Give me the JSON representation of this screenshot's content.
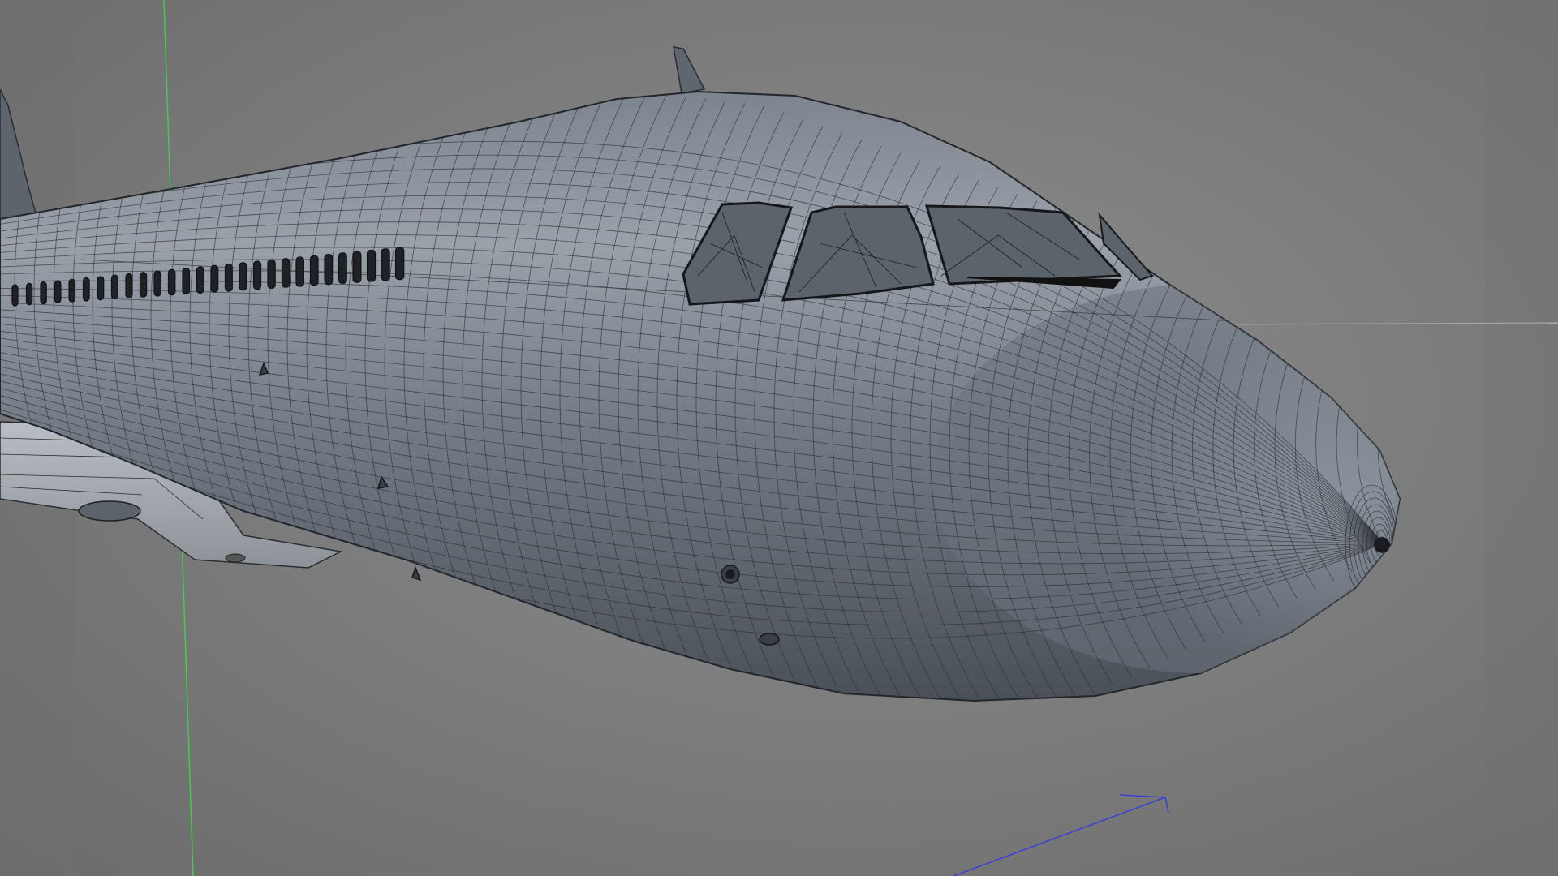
{
  "viewport": {
    "kind": "3d-modeling-viewport",
    "display_mode": "wireframe-on-shaded",
    "subject": "aircraft-fuselage-nose"
  },
  "colors": {
    "background_center": "#8a8a8a",
    "background_edge": "#6a6a6a",
    "mesh_fill": "#69717b",
    "mesh_highlight": "#9aa1a9",
    "mesh_shadow": "#3e444b",
    "wire": "#2a2e33",
    "axis_y": "#3fd14a",
    "axis_z": "#2f3fd8",
    "horizon_line": "#a8a8a8"
  },
  "icons": [
    "axis-y-line",
    "axis-z-arrow"
  ]
}
